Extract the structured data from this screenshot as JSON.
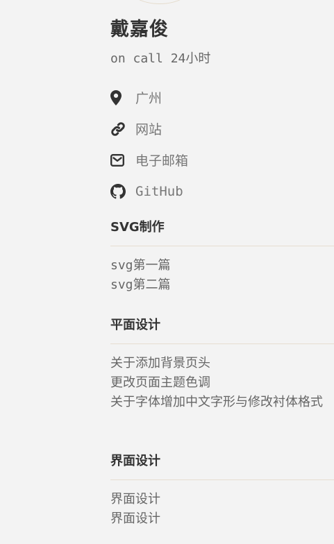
{
  "author": {
    "name": "戴嘉俊",
    "bio": "on call 24小时"
  },
  "links": [
    {
      "icon": "map-marker-icon",
      "label": "广州"
    },
    {
      "icon": "link-icon",
      "label": "网站"
    },
    {
      "icon": "envelope-icon",
      "label": "电子邮箱"
    },
    {
      "icon": "github-icon",
      "label": "GitHub"
    }
  ],
  "sections": [
    {
      "title": "SVG制作",
      "posts": [
        "svg第一篇",
        "svg第二篇"
      ]
    },
    {
      "title": "平面设计",
      "posts": [
        "关于添加背景页头",
        "更改页面主题色调",
        "关于字体增加中文字形与修改衬体格式"
      ]
    },
    {
      "title": "界面设计",
      "posts": [
        "界面设计",
        "界面设计"
      ]
    }
  ],
  "colors": {
    "background": "#f3f3f3",
    "divider": "#e6ddd0",
    "icon": "#333333"
  }
}
